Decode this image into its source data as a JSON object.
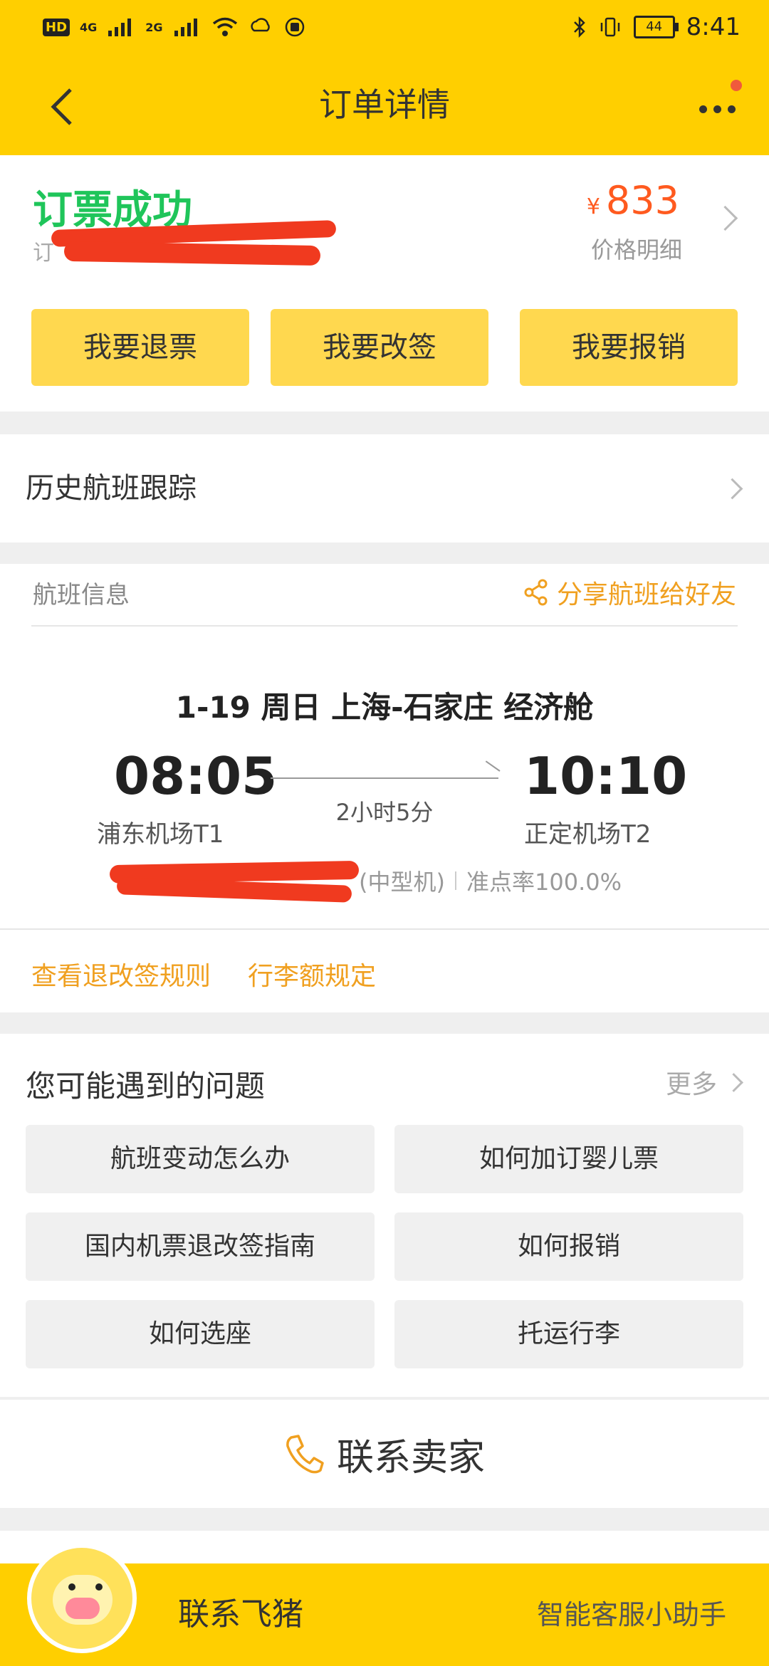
{
  "status_bar": {
    "hd": "HD",
    "net1": "4G",
    "net2": "2G",
    "battery": "44",
    "time": "8:41"
  },
  "header": {
    "title": "订单详情",
    "back_icon": "chevron-left-icon",
    "more_icon": "more-dots-icon"
  },
  "order_status": {
    "title": "订票成功",
    "subtitle_prefix": "订",
    "price_currency": "¥",
    "price": "833",
    "price_detail_label": "价格明细"
  },
  "actions": [
    {
      "label": "我要退票"
    },
    {
      "label": "我要改签"
    },
    {
      "label": "我要报销"
    }
  ],
  "history": {
    "label": "历史航班跟踪"
  },
  "flight": {
    "section_label": "航班信息",
    "share_label": "分享航班给好友",
    "route": "1-19  周日  上海-石家庄  经济舱",
    "dep_time": "08:05",
    "arr_time": "10:10",
    "duration": "2小时5分",
    "dep_airport": "浦东机场T1",
    "arr_airport": "正定机场T2",
    "aircraft": "(中型机)",
    "on_time": "准点率100.0%",
    "rules_link": "查看退改签规则",
    "baggage_link": "行李额规定"
  },
  "faq": {
    "title": "您可能遇到的问题",
    "more": "更多",
    "items": [
      {
        "label": "航班变动怎么办"
      },
      {
        "label": "如何加订婴儿票"
      },
      {
        "label": "国内机票退改签指南"
      },
      {
        "label": "如何报销"
      },
      {
        "label": "如何选座"
      },
      {
        "label": "托运行李"
      }
    ]
  },
  "contact": {
    "label": "联系卖家",
    "icon": "phone-icon"
  },
  "bottom_bar": {
    "contact_label": "联系飞猪",
    "assistant_label": "智能客服小助手"
  },
  "colors": {
    "brand_yellow": "#ffcf00",
    "button_yellow": "#ffd84f",
    "success_green": "#1fc55a",
    "price_orange": "#ff5a1f",
    "link_orange": "#f0a020",
    "redaction_red": "#f03a1f"
  }
}
